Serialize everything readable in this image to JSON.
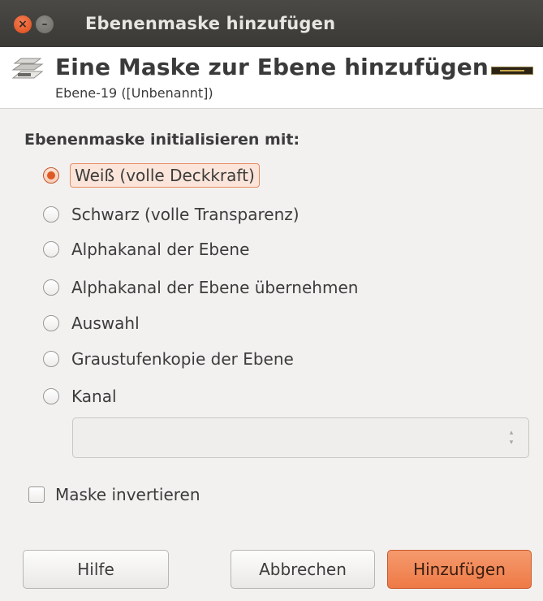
{
  "window": {
    "title": "Ebenenmaske hinzufügen",
    "close_glyph": "×",
    "minimize_glyph": "–"
  },
  "header": {
    "title": "Eine Maske zur Ebene hinzufügen",
    "subtitle": "Ebene-19 ([Unbenannt])",
    "icon": "layer-mask-icon"
  },
  "init_group": {
    "label": "Ebenenmaske initialisieren mit:",
    "options": [
      {
        "label": "Weiß (volle Deckkraft)",
        "checked": true
      },
      {
        "label": "Schwarz (volle Transparenz)",
        "checked": false
      },
      {
        "label": "Alphakanal der Ebene",
        "checked": false
      },
      {
        "label": "Alphakanal der Ebene übernehmen",
        "checked": false
      },
      {
        "label": "Auswahl",
        "checked": false
      },
      {
        "label": "Graustufenkopie der Ebene",
        "checked": false
      },
      {
        "label": "Kanal",
        "checked": false
      }
    ],
    "channel_select": {
      "value": "",
      "arrow_up": "▴",
      "arrow_down": "▾"
    }
  },
  "invert": {
    "label": "Maske invertieren",
    "checked": false
  },
  "buttons": {
    "help": "Hilfe",
    "cancel": "Abbrechen",
    "add": "Hinzufügen"
  },
  "colors": {
    "accent": "#ee7a46",
    "titlebar": "#3c3b37",
    "background": "#f2f1f0"
  }
}
